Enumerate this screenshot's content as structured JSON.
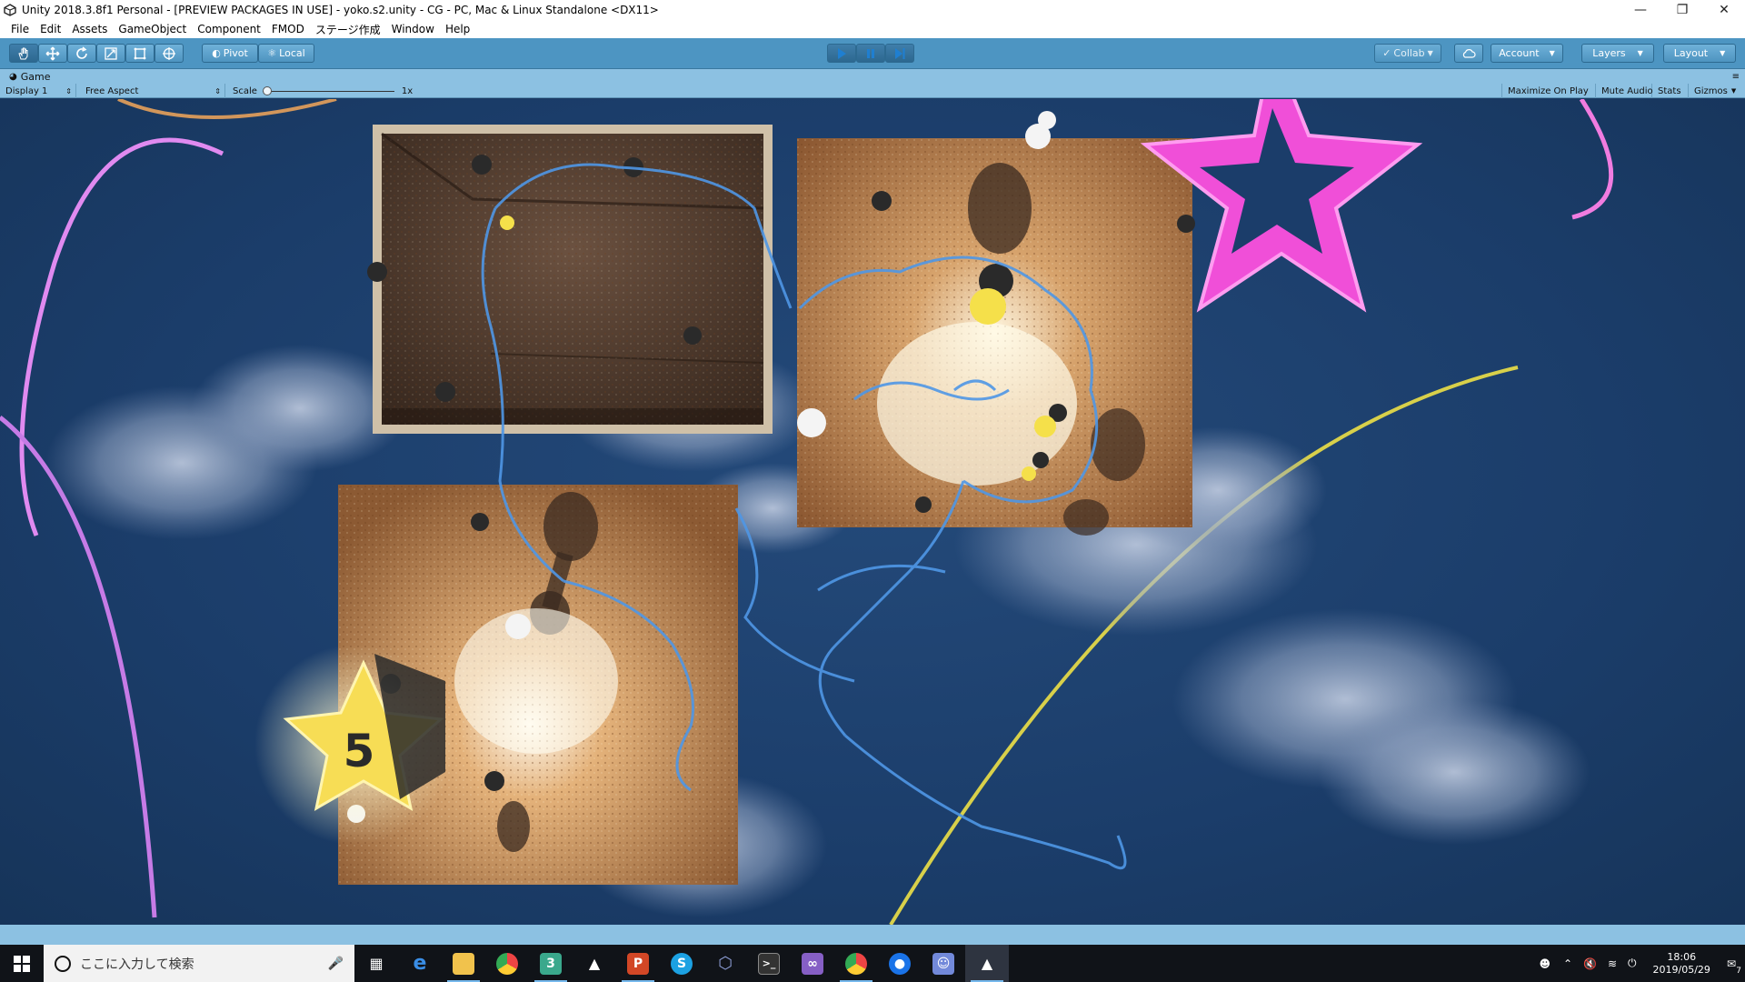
{
  "window": {
    "title": "Unity 2018.3.8f1 Personal - [PREVIEW PACKAGES IN USE] - yoko.s2.unity - CG - PC, Mac & Linux Standalone <DX11>",
    "controls": [
      "minimize-icon",
      "restore-icon",
      "close-icon"
    ]
  },
  "menu": [
    "File",
    "Edit",
    "Assets",
    "GameObject",
    "Component",
    "FMOD",
    "ステージ作成",
    "Window",
    "Help"
  ],
  "toolbar": {
    "tools": [
      "hand-tool-icon",
      "move-tool-icon",
      "rotate-tool-icon",
      "scale-tool-icon",
      "rect-tool-icon",
      "transform-tool-icon"
    ],
    "pivot_label": "Pivot",
    "local_label": "Local",
    "play_controls": [
      "play-icon",
      "pause-icon",
      "step-icon"
    ],
    "collab_label": "Collab",
    "account_label": "Account",
    "layers_label": "Layers",
    "layout_label": "Layout"
  },
  "game_view": {
    "tab_label": "Game",
    "display_label": "Display 1",
    "aspect_label": "Free Aspect",
    "scale_label": "Scale",
    "scale_value": "1x",
    "maximize_label": "Maximize On Play",
    "mute_label": "Mute Audio",
    "stats_label": "Stats",
    "gizmos_label": "Gizmos",
    "star_number": "5"
  },
  "taskbar": {
    "search_placeholder": "ここに入力して検索",
    "time": "18:06",
    "date": "2019/05/29",
    "notification_count": "7"
  },
  "colors": {
    "toolbar": "#4d95c2",
    "panel": "#8cc1e2",
    "sky": "#1b3d6a",
    "star_pink": "#f04fd8",
    "star_yellow": "#f7dd55",
    "line_yellow": "#d9d24a"
  }
}
